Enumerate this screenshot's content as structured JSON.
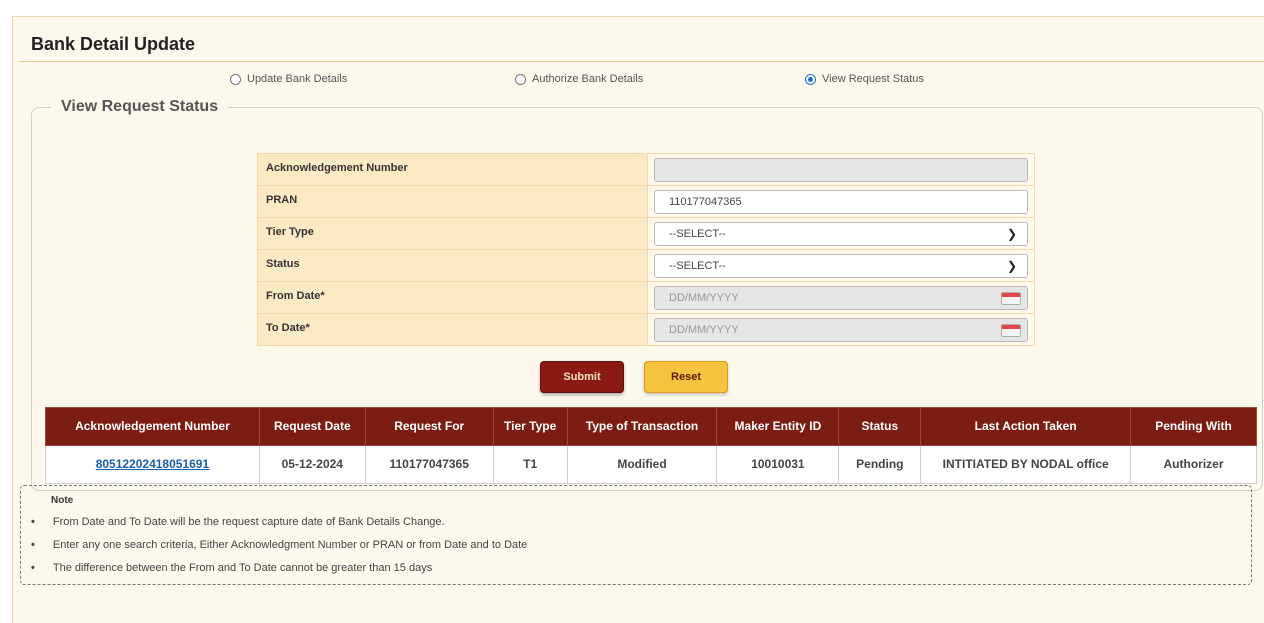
{
  "page_title": "Bank Detail Update",
  "mode_options": [
    {
      "label": "Update Bank Details",
      "selected": false
    },
    {
      "label": "Authorize Bank Details",
      "selected": false
    },
    {
      "label": "View Request Status",
      "selected": true
    }
  ],
  "section_legend": "View Request Status",
  "form": {
    "ack_label": "Acknowledgement Number",
    "ack_value": "",
    "pran_label": "PRAN",
    "pran_value": "110177047365",
    "tier_label": "Tier Type",
    "tier_value": "--SELECT--",
    "status_label": "Status",
    "status_value": "--SELECT--",
    "from_label": "From Date*",
    "from_placeholder": "DD/MM/YYYY",
    "to_label": "To Date*",
    "to_placeholder": "DD/MM/YYYY"
  },
  "buttons": {
    "submit": "Submit",
    "reset": "Reset"
  },
  "results": {
    "headers": [
      "Acknowledgement Number",
      "Request Date",
      "Request For",
      "Tier Type",
      "Type of Transaction",
      "Maker Entity ID",
      "Status",
      "Last Action Taken",
      "Pending With"
    ],
    "rows": [
      [
        "80512202418051691",
        "05-12-2024",
        "110177047365",
        "T1",
        "Modified",
        "10010031",
        "Pending",
        "INTITIATED BY NODAL office",
        "Authorizer"
      ]
    ]
  },
  "note": {
    "title": "Note",
    "bullet": "•",
    "items": [
      "From Date and To Date will be the request capture date of Bank Details Change.",
      "Enter any one search criteria, Either Acknowledgment Number or PRAN or from Date and to Date",
      "The difference between the From and To Date cannot be greater than 15 days"
    ]
  },
  "colors": {
    "page_bg": "#fdf8ec",
    "header_maroon": "#7b1d12",
    "submit_bg": "#8b1a12",
    "reset_bg": "#f7c440",
    "label_bg": "#fde9c4",
    "link": "#1b5fb0"
  }
}
